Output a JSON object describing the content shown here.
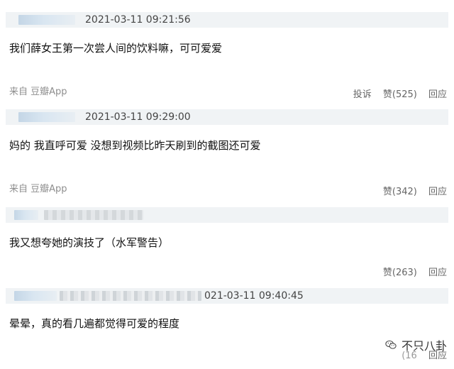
{
  "comments": [
    {
      "timestamp": "2021-03-11 09:21:56",
      "text": "我们薛女王第一次尝人间的饮料嘛，可可爱爱",
      "source": "来自 豆瓣App",
      "report_label": "投诉",
      "like_label": "赞",
      "like_count": "(525)",
      "reply_label": "回应"
    },
    {
      "timestamp": "2021-03-11 09:29:00",
      "text": "妈的 我直呼可爱 没想到视频比昨天刷到的截图还可爱",
      "source": "来自 豆瓣App",
      "like_label": "赞",
      "like_count": "(342)",
      "reply_label": "回应"
    },
    {
      "text": "我又想夸她的演技了（水军警告）",
      "like_label": "赞",
      "like_count": "(263)",
      "reply_label": "回应"
    },
    {
      "timestamp": "021-03-11 09:40:45",
      "text": "晕晕，真的看几遍都觉得可爱的程度",
      "like_count_partial": "(16",
      "reply_label": "回应"
    }
  ],
  "watermark": {
    "text": "不只八卦",
    "icon": "wechat-icon"
  }
}
